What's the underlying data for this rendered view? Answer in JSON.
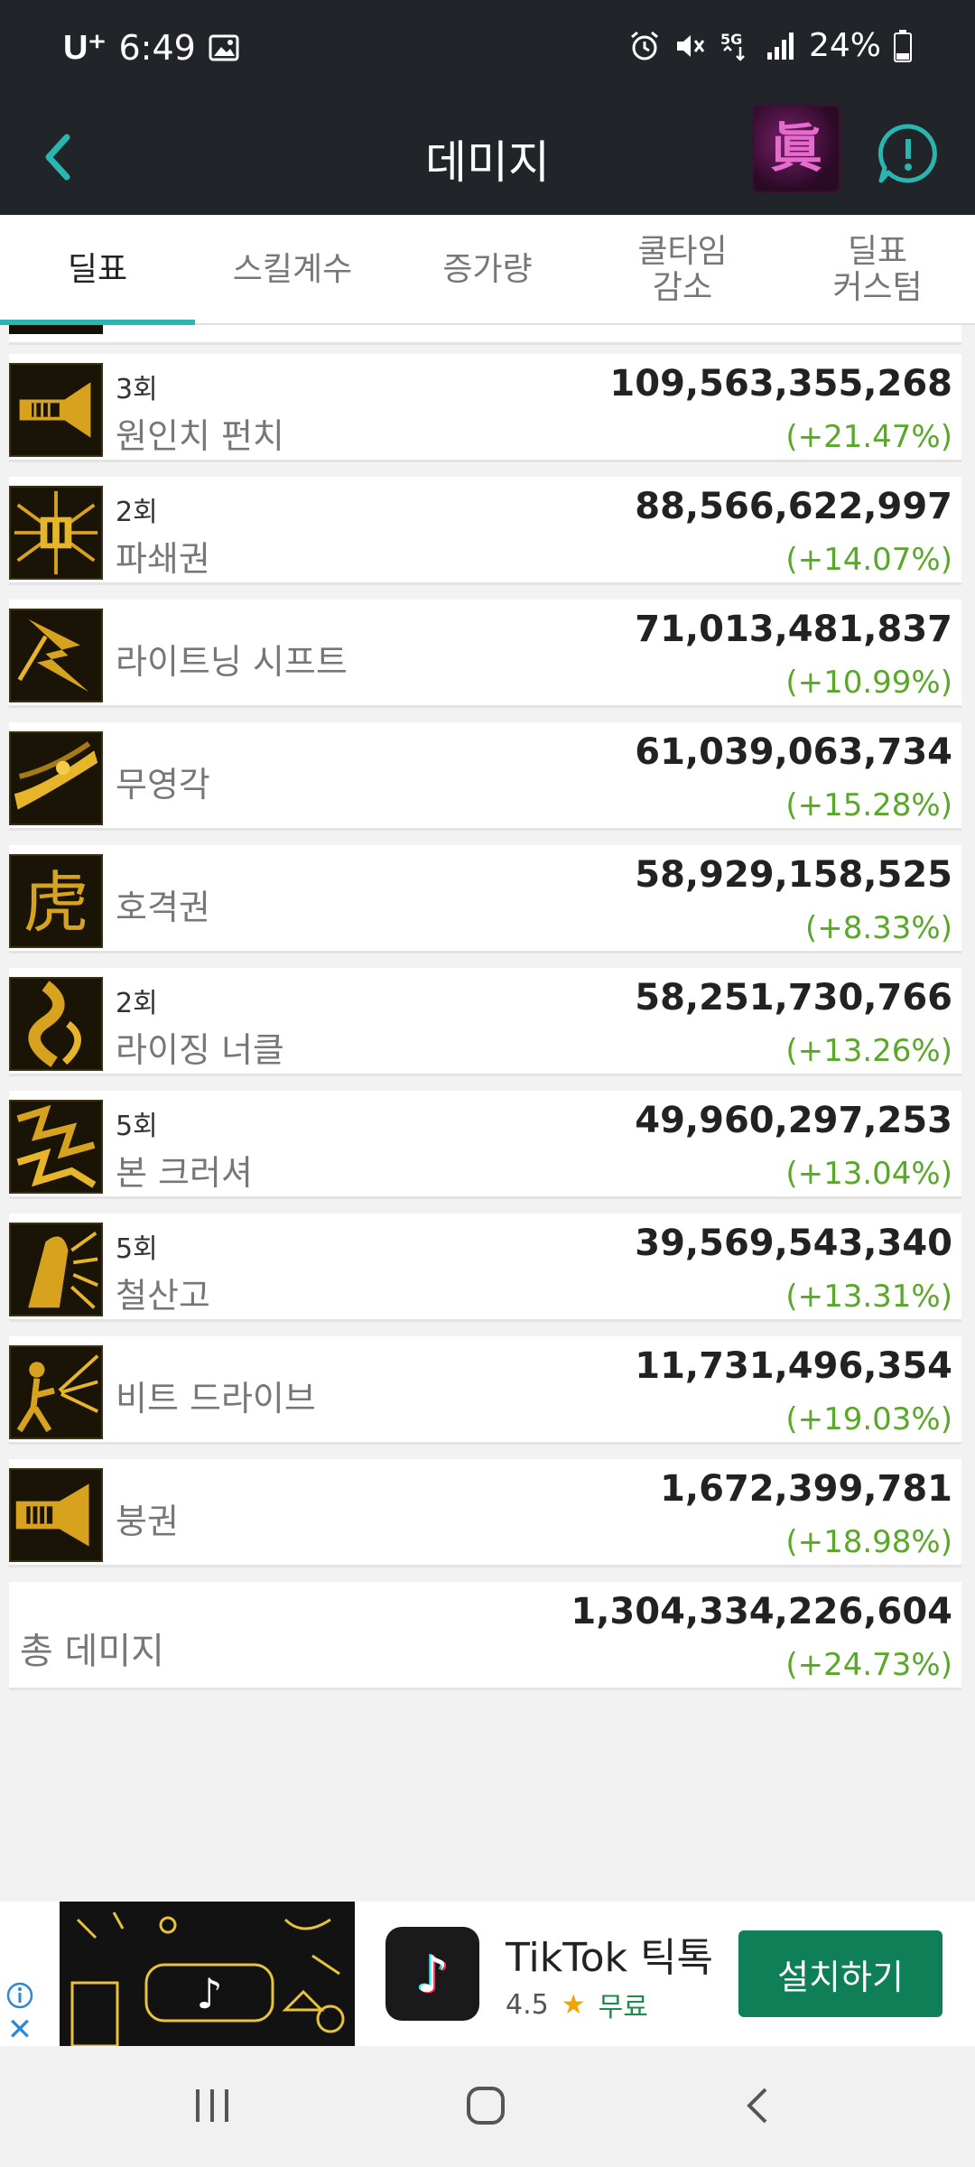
{
  "status": {
    "carrier": "U⁺",
    "time": "6:49",
    "battery": "24%",
    "icons": [
      "image-icon",
      "alarm-icon",
      "mute-icon",
      "5g-icon",
      "signal-icon",
      "battery-icon"
    ]
  },
  "appbar": {
    "title": "데미지",
    "icons": [
      "back-icon",
      "character-avatar",
      "alert-icon"
    ]
  },
  "tabs": [
    {
      "label": "딜표",
      "active": true
    },
    {
      "label": "스킬계수",
      "active": false
    },
    {
      "label": "증가량",
      "active": false
    },
    {
      "label": "쿨타임\n감소",
      "active": false
    },
    {
      "label": "딜표\n커스텀",
      "active": false
    }
  ],
  "skills": [
    {
      "hits": "3회",
      "name": "원인치 펀치",
      "damage": "109,563,355,268",
      "increase": "(+21.47%)",
      "icon": "fist-punch-icon"
    },
    {
      "hits": "2회",
      "name": "파쇄권",
      "damage": "88,566,622,997",
      "increase": "(+14.07%)",
      "icon": "shatter-fist-icon"
    },
    {
      "hits": "",
      "name": "라이트닝 시프트",
      "damage": "71,013,481,837",
      "increase": "(+10.99%)",
      "icon": "lightning-shift-icon"
    },
    {
      "hits": "",
      "name": "무영각",
      "damage": "61,039,063,734",
      "increase": "(+15.28%)",
      "icon": "shadow-kick-icon"
    },
    {
      "hits": "",
      "name": "호격권",
      "damage": "58,929,158,525",
      "increase": "(+8.33%)",
      "icon": "tiger-fist-icon"
    },
    {
      "hits": "2회",
      "name": "라이징 너클",
      "damage": "58,251,730,766",
      "increase": "(+13.26%)",
      "icon": "rising-knuckle-icon"
    },
    {
      "hits": "5회",
      "name": "본 크러셔",
      "damage": "49,960,297,253",
      "increase": "(+13.04%)",
      "icon": "bone-crusher-icon"
    },
    {
      "hits": "5회",
      "name": "철산고",
      "damage": "39,569,543,340",
      "increase": "(+13.31%)",
      "icon": "iron-mountain-icon"
    },
    {
      "hits": "",
      "name": "비트 드라이브",
      "damage": "11,731,496,354",
      "increase": "(+19.03%)",
      "icon": "beat-drive-icon"
    },
    {
      "hits": "",
      "name": "붕권",
      "damage": "1,672,399,781",
      "increase": "(+18.98%)",
      "icon": "collapse-fist-icon"
    }
  ],
  "total": {
    "label": "총 데미지",
    "damage": "1,304,334,226,604",
    "increase": "(+24.73%)"
  },
  "ad": {
    "app_name": "TikTok 틱톡",
    "rating": "4.5",
    "star": "★",
    "price": "무료",
    "install_label": "설치하기",
    "close": "✕"
  },
  "colors": {
    "bar_bg": "#212529",
    "accent": "#2bb5b0",
    "increase": "#5aa829",
    "install": "#0f7f58"
  }
}
